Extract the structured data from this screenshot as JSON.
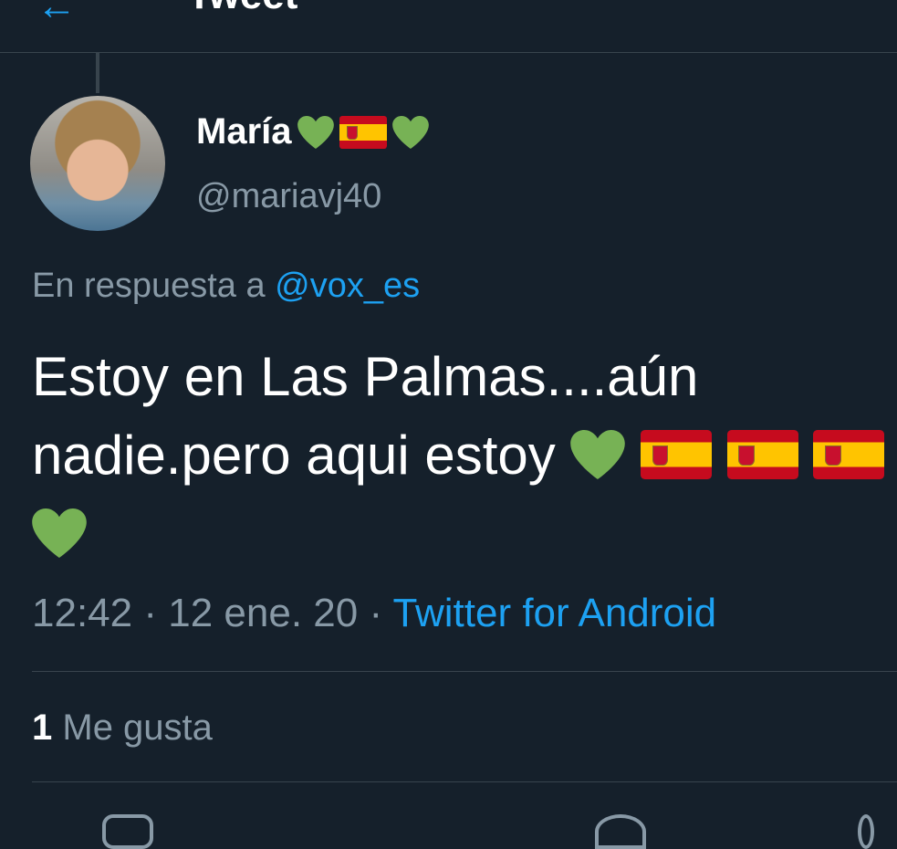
{
  "header": {
    "title": "Tweet"
  },
  "tweet": {
    "author_name": "María",
    "author_handle": "@mariavj40",
    "reply_prefix": "En respuesta a",
    "reply_mention": "@vox_es",
    "text": "Estoy en Las Palmas....aún nadie.pero aqui estoy",
    "time": "12:42",
    "date": "12 ene. 20",
    "source": "Twitter for Android",
    "like_count": "1",
    "like_label": "Me gusta"
  },
  "icons": {
    "heart_color": "#77b255",
    "flag": "spain-flag-icon"
  },
  "colors": {
    "background": "#15202b",
    "muted": "#8899a6",
    "link": "#1da1f2",
    "divider": "#38444d"
  }
}
